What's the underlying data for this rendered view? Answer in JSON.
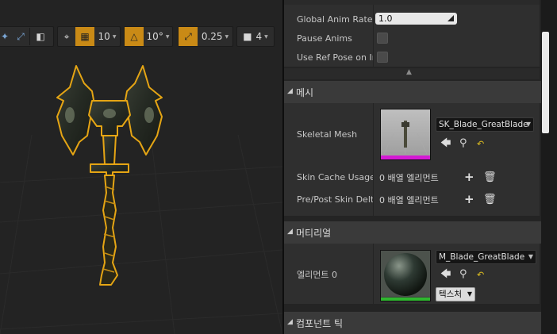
{
  "viewport": {
    "toolbar": {
      "grid_snap_value": "10",
      "rotation_snap_value": "10°",
      "scale_snap_value": "0.25",
      "camera_speed_value": "4"
    },
    "icons": [
      "rotate-icon",
      "maximize-icon",
      "cube-icon",
      "surface-snap-icon",
      "grid-icon",
      "angle-icon",
      "scale-icon",
      "camera-icon",
      "dropdown-arrow-icon"
    ]
  },
  "details": {
    "anim": {
      "global_rate_label": "Global Anim Rate S",
      "global_rate_value": "1.0",
      "pause_anims_label": "Pause Anims",
      "use_ref_pose_label": "Use Ref Pose on Ini"
    },
    "mesh_section": {
      "title": "메시",
      "skeletal_mesh_label": "Skeletal Mesh",
      "skeletal_mesh_value": "SK_Blade_GreatBlade",
      "skin_cache_label": "Skin Cache Usage",
      "skin_cache_value": "0 배열 엘리먼트",
      "pre_post_label": "Pre/Post Skin Delta",
      "pre_post_value": "0 배열 엘리먼트"
    },
    "material_section": {
      "title": "머티리얼",
      "element_label": "엘리먼트 0",
      "material_value": "M_Blade_GreatBlade",
      "textures_button": "텍스처"
    },
    "component_tick_section": {
      "title": "컴포넌트 틱"
    },
    "colors": {
      "mesh_thumb_bar": "#d41ad4",
      "material_thumb_bar": "#2fb82f",
      "toolbar_active": "#c98a16"
    }
  }
}
